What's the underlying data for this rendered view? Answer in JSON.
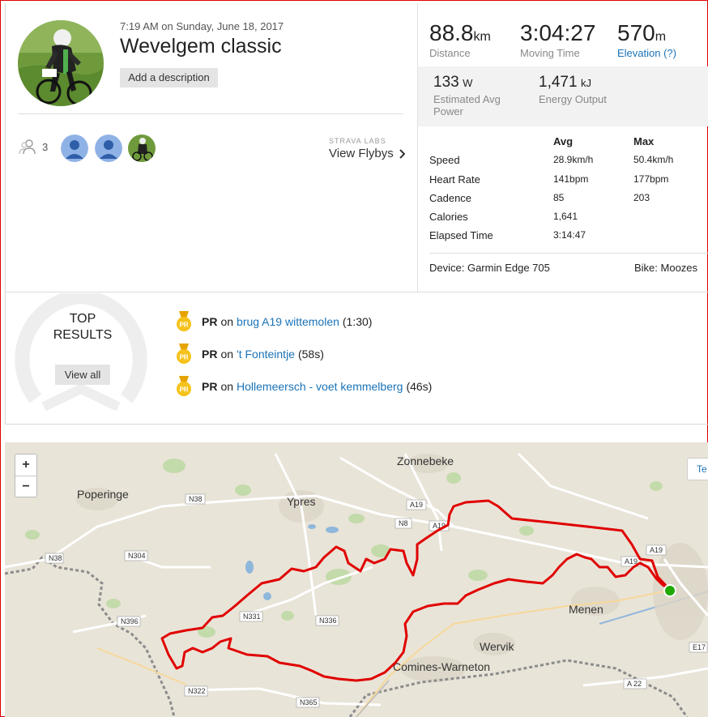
{
  "activity": {
    "timestamp": "7:19 AM on Sunday, June 18, 2017",
    "title": "Wevelgem classic",
    "add_description": "Add a description"
  },
  "social": {
    "athlete_count": "3",
    "labs_label": "STRAVA LABS",
    "flybys_label": "View Flybys"
  },
  "stats": {
    "distance": {
      "value": "88.8",
      "unit": "km",
      "label": "Distance"
    },
    "moving_time": {
      "value": "3:04:27",
      "label": "Moving Time"
    },
    "elevation": {
      "value": "570",
      "unit": "m",
      "label": "Elevation (?)"
    },
    "power": {
      "value": "133",
      "unit": "W",
      "label_line1": "Estimated Avg",
      "label_line2": "Power"
    },
    "energy": {
      "value": "1,471",
      "unit": "kJ",
      "label": "Energy Output"
    }
  },
  "table": {
    "headers": {
      "avg": "Avg",
      "max": "Max"
    },
    "rows": [
      {
        "label": "Speed",
        "avg": "28.9km/h",
        "max": "50.4km/h"
      },
      {
        "label": "Heart Rate",
        "avg": "141bpm",
        "max": "177bpm"
      },
      {
        "label": "Cadence",
        "avg": "85",
        "max": "203"
      },
      {
        "label": "Calories",
        "avg": "1,641",
        "max": ""
      },
      {
        "label": "Elapsed Time",
        "avg": "3:14:47",
        "max": ""
      }
    ]
  },
  "equipment": {
    "device": "Device: Garmin Edge 705",
    "bike": "Bike: Moozes"
  },
  "top_results": {
    "title_line1": "TOP",
    "title_line2": "RESULTS",
    "view_all": "View all",
    "items": [
      {
        "badge": "PR",
        "on": "on",
        "segment": "brug A19 wittemolen",
        "time": "(1:30)"
      },
      {
        "badge": "PR",
        "on": "on",
        "segment": "'t Fonteintje",
        "time": "(58s)"
      },
      {
        "badge": "PR",
        "on": "on",
        "segment": "Hollemeersch - voet kemmelberg",
        "time": "(46s)"
      }
    ]
  },
  "map": {
    "zoom_in": "+",
    "zoom_out": "−",
    "map_type": "Te",
    "places": [
      "Zonnebeke",
      "Poperinge",
      "Ypres",
      "Menen",
      "Wervik",
      "Comines-Warneton"
    ],
    "roads": [
      "N38",
      "A19",
      "N8",
      "A19",
      "N38",
      "N304",
      "A19",
      "A19",
      "N396",
      "N331",
      "N336",
      "N322",
      "N365",
      "E17",
      "A 22"
    ],
    "route_color": "#e00000",
    "start_color": "#1faa00"
  },
  "colors": {
    "link": "#1a73b8",
    "border": "#e00000",
    "medal": "#f0b400"
  }
}
